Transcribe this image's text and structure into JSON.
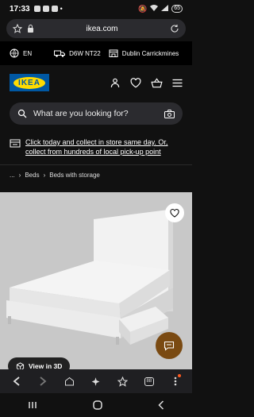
{
  "status_bar": {
    "time": "17:33",
    "battery": "65"
  },
  "browser": {
    "url": "ikea.com"
  },
  "locale": {
    "language": "EN",
    "postcode": "D6W NT22",
    "store": "Dublin Carrickmines"
  },
  "header": {
    "logo_text": "IKEA"
  },
  "search": {
    "placeholder": "What are you looking for?"
  },
  "promo": {
    "text": "Click today and collect in store same day. Or, collect from hundreds of local pick-up point"
  },
  "breadcrumb": {
    "ellipsis": "...",
    "items": [
      "Beds",
      "Beds with storage"
    ]
  },
  "product": {
    "view_3d_label": "View in 3D"
  },
  "icons": {
    "accent_color": "#0058a3",
    "logo_yellow": "#ffdb00",
    "chat_color": "#7a4a12"
  }
}
